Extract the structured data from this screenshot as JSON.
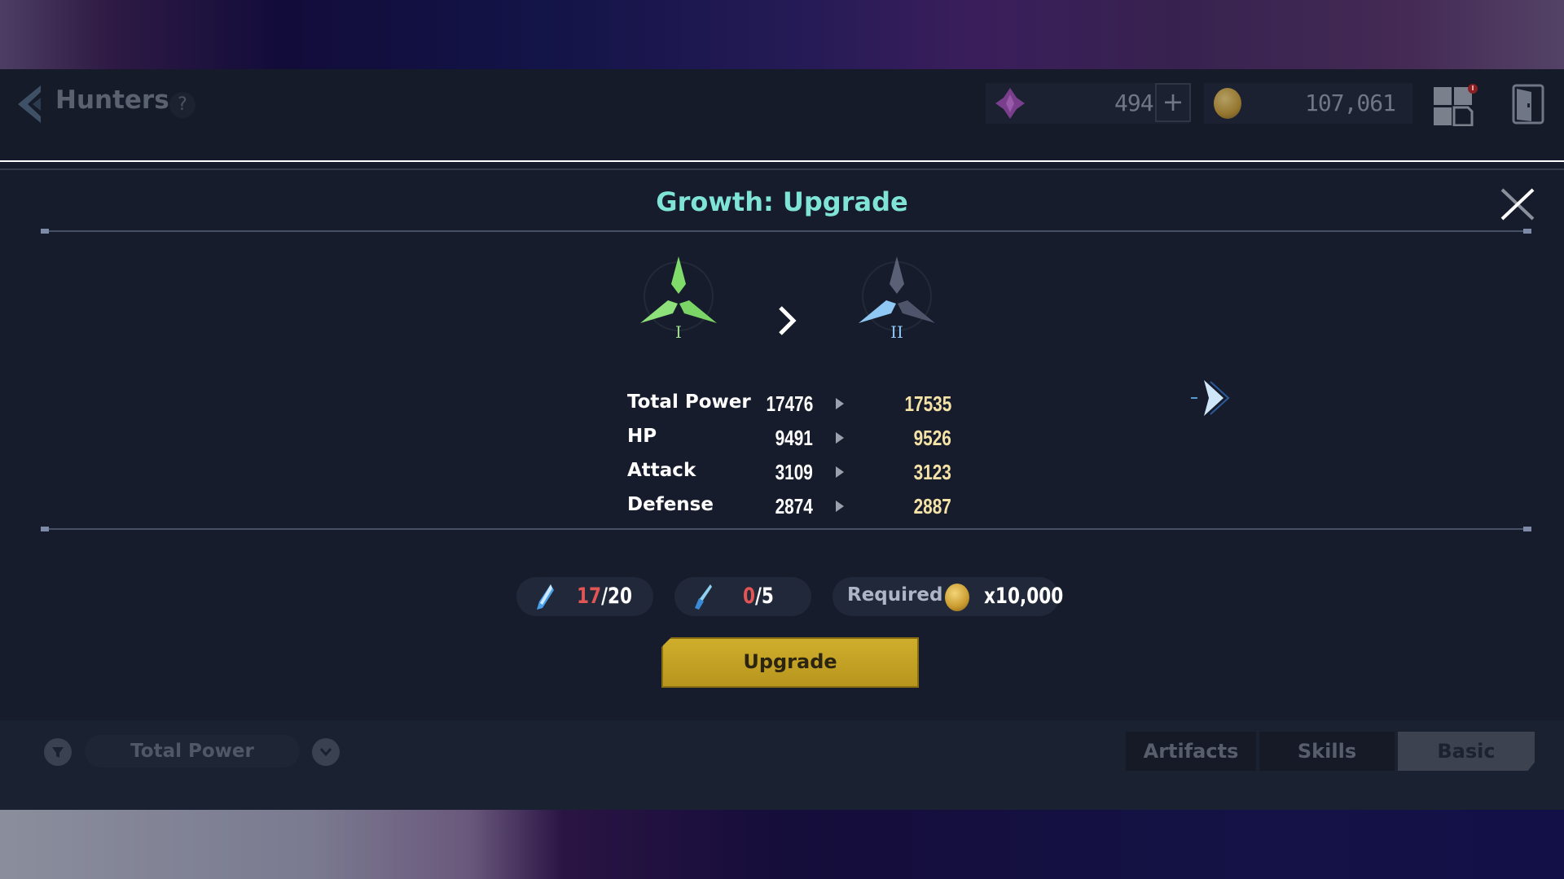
{
  "header": {
    "title": "Hunters",
    "help_label": "?",
    "gems_value": "494",
    "plus_label": "+",
    "gold_value": "107,061"
  },
  "modal": {
    "title": "Growth: Upgrade",
    "rank_from": "I",
    "rank_to": "II",
    "stats": [
      {
        "label": "Total Power",
        "current": "17476",
        "next": "17535"
      },
      {
        "label": "HP",
        "current": "9491",
        "next": "9526"
      },
      {
        "label": "Attack",
        "current": "3109",
        "next": "3123"
      },
      {
        "label": "Defense",
        "current": "2874",
        "next": "2887"
      }
    ],
    "materials": [
      {
        "owned": "17",
        "required": "/20"
      },
      {
        "owned": "0",
        "required": "/5"
      }
    ],
    "required_label": "Required",
    "required_cost": "x10,000",
    "upgrade_label": "Upgrade"
  },
  "footer": {
    "sort_label": "Total Power",
    "tabs": [
      {
        "label": "Artifacts",
        "active": false
      },
      {
        "label": "Skills",
        "active": false
      },
      {
        "label": "Basic",
        "active": true
      }
    ]
  },
  "colors": {
    "title_accent": "#7fe3d6",
    "next_value": "#f4e2a6",
    "insufficient": "#e25555",
    "upgrade_button": "#c8a526"
  }
}
